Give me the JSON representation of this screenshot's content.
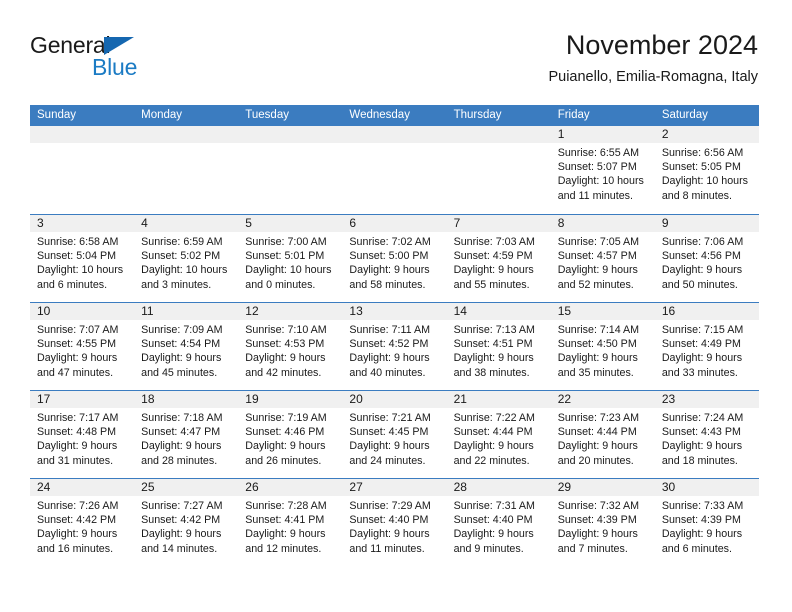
{
  "brand": {
    "name_top": "General",
    "name_bottom": "Blue",
    "triangle_color": "#1567b0",
    "blue_color": "#1b7bc4"
  },
  "header": {
    "title": "November 2024",
    "subtitle": "Puianello, Emilia-Romagna, Italy",
    "accent_color": "#3b7cc0",
    "daynum_band_color": "#f0f0f0"
  },
  "calendar": {
    "weekday_headers": [
      "Sunday",
      "Monday",
      "Tuesday",
      "Wednesday",
      "Thursday",
      "Friday",
      "Saturday"
    ],
    "weeks": [
      [
        {
          "day": "",
          "empty": true,
          "lines": []
        },
        {
          "day": "",
          "empty": true,
          "lines": []
        },
        {
          "day": "",
          "empty": true,
          "lines": []
        },
        {
          "day": "",
          "empty": true,
          "lines": []
        },
        {
          "day": "",
          "empty": true,
          "lines": []
        },
        {
          "day": "1",
          "empty": false,
          "lines": [
            "Sunrise: 6:55 AM",
            "Sunset: 5:07 PM",
            "Daylight: 10 hours",
            "and 11 minutes."
          ]
        },
        {
          "day": "2",
          "empty": false,
          "lines": [
            "Sunrise: 6:56 AM",
            "Sunset: 5:05 PM",
            "Daylight: 10 hours",
            "and 8 minutes."
          ]
        }
      ],
      [
        {
          "day": "3",
          "empty": false,
          "lines": [
            "Sunrise: 6:58 AM",
            "Sunset: 5:04 PM",
            "Daylight: 10 hours",
            "and 6 minutes."
          ]
        },
        {
          "day": "4",
          "empty": false,
          "lines": [
            "Sunrise: 6:59 AM",
            "Sunset: 5:02 PM",
            "Daylight: 10 hours",
            "and 3 minutes."
          ]
        },
        {
          "day": "5",
          "empty": false,
          "lines": [
            "Sunrise: 7:00 AM",
            "Sunset: 5:01 PM",
            "Daylight: 10 hours",
            "and 0 minutes."
          ]
        },
        {
          "day": "6",
          "empty": false,
          "lines": [
            "Sunrise: 7:02 AM",
            "Sunset: 5:00 PM",
            "Daylight: 9 hours",
            "and 58 minutes."
          ]
        },
        {
          "day": "7",
          "empty": false,
          "lines": [
            "Sunrise: 7:03 AM",
            "Sunset: 4:59 PM",
            "Daylight: 9 hours",
            "and 55 minutes."
          ]
        },
        {
          "day": "8",
          "empty": false,
          "lines": [
            "Sunrise: 7:05 AM",
            "Sunset: 4:57 PM",
            "Daylight: 9 hours",
            "and 52 minutes."
          ]
        },
        {
          "day": "9",
          "empty": false,
          "lines": [
            "Sunrise: 7:06 AM",
            "Sunset: 4:56 PM",
            "Daylight: 9 hours",
            "and 50 minutes."
          ]
        }
      ],
      [
        {
          "day": "10",
          "empty": false,
          "lines": [
            "Sunrise: 7:07 AM",
            "Sunset: 4:55 PM",
            "Daylight: 9 hours",
            "and 47 minutes."
          ]
        },
        {
          "day": "11",
          "empty": false,
          "lines": [
            "Sunrise: 7:09 AM",
            "Sunset: 4:54 PM",
            "Daylight: 9 hours",
            "and 45 minutes."
          ]
        },
        {
          "day": "12",
          "empty": false,
          "lines": [
            "Sunrise: 7:10 AM",
            "Sunset: 4:53 PM",
            "Daylight: 9 hours",
            "and 42 minutes."
          ]
        },
        {
          "day": "13",
          "empty": false,
          "lines": [
            "Sunrise: 7:11 AM",
            "Sunset: 4:52 PM",
            "Daylight: 9 hours",
            "and 40 minutes."
          ]
        },
        {
          "day": "14",
          "empty": false,
          "lines": [
            "Sunrise: 7:13 AM",
            "Sunset: 4:51 PM",
            "Daylight: 9 hours",
            "and 38 minutes."
          ]
        },
        {
          "day": "15",
          "empty": false,
          "lines": [
            "Sunrise: 7:14 AM",
            "Sunset: 4:50 PM",
            "Daylight: 9 hours",
            "and 35 minutes."
          ]
        },
        {
          "day": "16",
          "empty": false,
          "lines": [
            "Sunrise: 7:15 AM",
            "Sunset: 4:49 PM",
            "Daylight: 9 hours",
            "and 33 minutes."
          ]
        }
      ],
      [
        {
          "day": "17",
          "empty": false,
          "lines": [
            "Sunrise: 7:17 AM",
            "Sunset: 4:48 PM",
            "Daylight: 9 hours",
            "and 31 minutes."
          ]
        },
        {
          "day": "18",
          "empty": false,
          "lines": [
            "Sunrise: 7:18 AM",
            "Sunset: 4:47 PM",
            "Daylight: 9 hours",
            "and 28 minutes."
          ]
        },
        {
          "day": "19",
          "empty": false,
          "lines": [
            "Sunrise: 7:19 AM",
            "Sunset: 4:46 PM",
            "Daylight: 9 hours",
            "and 26 minutes."
          ]
        },
        {
          "day": "20",
          "empty": false,
          "lines": [
            "Sunrise: 7:21 AM",
            "Sunset: 4:45 PM",
            "Daylight: 9 hours",
            "and 24 minutes."
          ]
        },
        {
          "day": "21",
          "empty": false,
          "lines": [
            "Sunrise: 7:22 AM",
            "Sunset: 4:44 PM",
            "Daylight: 9 hours",
            "and 22 minutes."
          ]
        },
        {
          "day": "22",
          "empty": false,
          "lines": [
            "Sunrise: 7:23 AM",
            "Sunset: 4:44 PM",
            "Daylight: 9 hours",
            "and 20 minutes."
          ]
        },
        {
          "day": "23",
          "empty": false,
          "lines": [
            "Sunrise: 7:24 AM",
            "Sunset: 4:43 PM",
            "Daylight: 9 hours",
            "and 18 minutes."
          ]
        }
      ],
      [
        {
          "day": "24",
          "empty": false,
          "lines": [
            "Sunrise: 7:26 AM",
            "Sunset: 4:42 PM",
            "Daylight: 9 hours",
            "and 16 minutes."
          ]
        },
        {
          "day": "25",
          "empty": false,
          "lines": [
            "Sunrise: 7:27 AM",
            "Sunset: 4:42 PM",
            "Daylight: 9 hours",
            "and 14 minutes."
          ]
        },
        {
          "day": "26",
          "empty": false,
          "lines": [
            "Sunrise: 7:28 AM",
            "Sunset: 4:41 PM",
            "Daylight: 9 hours",
            "and 12 minutes."
          ]
        },
        {
          "day": "27",
          "empty": false,
          "lines": [
            "Sunrise: 7:29 AM",
            "Sunset: 4:40 PM",
            "Daylight: 9 hours",
            "and 11 minutes."
          ]
        },
        {
          "day": "28",
          "empty": false,
          "lines": [
            "Sunrise: 7:31 AM",
            "Sunset: 4:40 PM",
            "Daylight: 9 hours",
            "and 9 minutes."
          ]
        },
        {
          "day": "29",
          "empty": false,
          "lines": [
            "Sunrise: 7:32 AM",
            "Sunset: 4:39 PM",
            "Daylight: 9 hours",
            "and 7 minutes."
          ]
        },
        {
          "day": "30",
          "empty": false,
          "lines": [
            "Sunrise: 7:33 AM",
            "Sunset: 4:39 PM",
            "Daylight: 9 hours",
            "and 6 minutes."
          ]
        }
      ]
    ]
  }
}
